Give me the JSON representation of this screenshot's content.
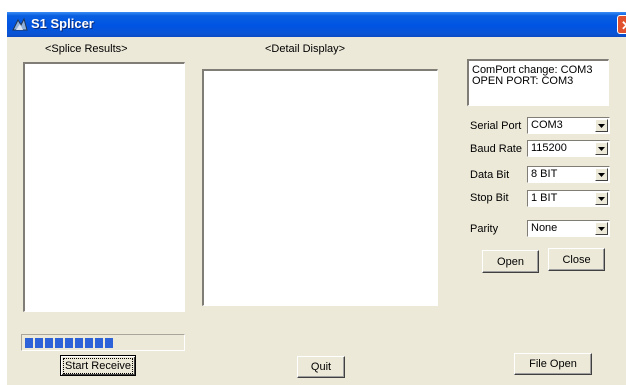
{
  "window": {
    "title": "S1 Splicer",
    "close_glyph": "✕",
    "app_icon": "splicer-app-icon"
  },
  "labels": {
    "splice_results": "<Splice Results>",
    "detail_display": "<Detail Display>"
  },
  "status_box": {
    "lines": [
      "ComPort change: COM3",
      "OPEN PORT: COM3"
    ]
  },
  "settings": {
    "serial_port": {
      "label": "Serial Port",
      "value": "COM3"
    },
    "baud_rate": {
      "label": "Baud Rate",
      "value": "115200"
    },
    "data_bit": {
      "label": "Data Bit",
      "value": "8 BIT"
    },
    "stop_bit": {
      "label": "Stop Bit",
      "value": "1 BIT"
    },
    "parity": {
      "label": "Parity",
      "value": "None"
    }
  },
  "buttons": {
    "open": "Open",
    "close": "Close",
    "start_receive": "Start Receive",
    "quit": "Quit",
    "file_open": "File Open"
  },
  "progress": {
    "fraction": 0.6,
    "color": "#2d62d9"
  },
  "colors": {
    "titlebar": "#0054e3",
    "face": "#ece9d8",
    "close_button": "#e2512e"
  }
}
